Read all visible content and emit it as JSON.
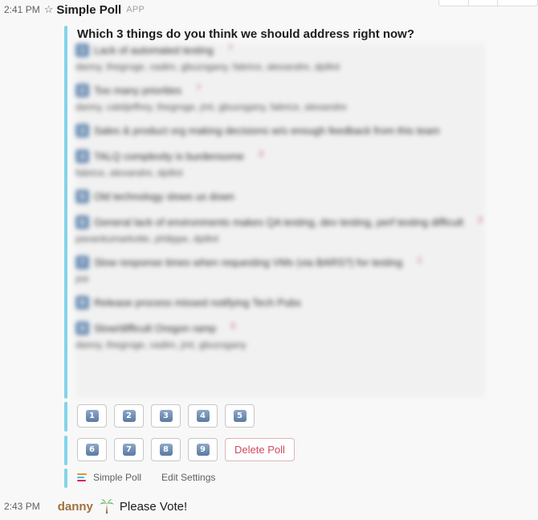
{
  "message": {
    "time": "2:41 PM",
    "sender": "Simple Poll",
    "badge": "APP",
    "question": "Which 3 things do you think we should address right now?",
    "options": [
      {
        "num": "1",
        "text": "Lack of automated testing",
        "count": "7",
        "voters": "danny, thegroge, vadim, gbuzogany, fabrice, alexandre, dpillot"
      },
      {
        "num": "2",
        "text": "Too many priorities",
        "count": "7",
        "voters": "danny, caleljeffrey, thegroge, jmt, gbuzogany, fabrice, alexandre"
      },
      {
        "num": "3",
        "text": "Sales & product org making decisions w/o enough feedback from this team",
        "count": "",
        "voters": ""
      },
      {
        "num": "4",
        "text": "TALQ complexity is burdensome",
        "count": "3",
        "voters": "fabrice, alexandre, dpillot"
      },
      {
        "num": "5",
        "text": "Old technology slows us down",
        "count": "",
        "voters": ""
      },
      {
        "num": "6",
        "text": "General lack of environments makes QA testing, dev testing, perf testing difficult",
        "count": "3",
        "voters": "pavankumarkotte, philippe, dpillot"
      },
      {
        "num": "7",
        "text": "Slow response times when requesting VMs (via BARS?) for testing",
        "count": "1",
        "voters": "jmt"
      },
      {
        "num": "8",
        "text": "Release process missed notifying Tech Pubs",
        "count": "",
        "voters": ""
      },
      {
        "num": "9",
        "text": "Slow/difficult Oregon ramp",
        "count": "5",
        "voters": "danny, thegroge, vadim, jmt, gbuzogany"
      }
    ],
    "buttons_row1": [
      "1",
      "2",
      "3",
      "4",
      "5"
    ],
    "buttons_row2": [
      "6",
      "7",
      "8",
      "9"
    ],
    "delete_label": "Delete Poll",
    "footer_app": "Simple Poll",
    "footer_edit": "Edit Settings"
  },
  "reply": {
    "time": "2:43 PM",
    "user": "danny",
    "emoji": "palm-tree",
    "text": "Please Vote!"
  },
  "colors": {
    "accent_bar": "#83d3e8",
    "delete": "#d1495b",
    "username": "#a0703a"
  }
}
